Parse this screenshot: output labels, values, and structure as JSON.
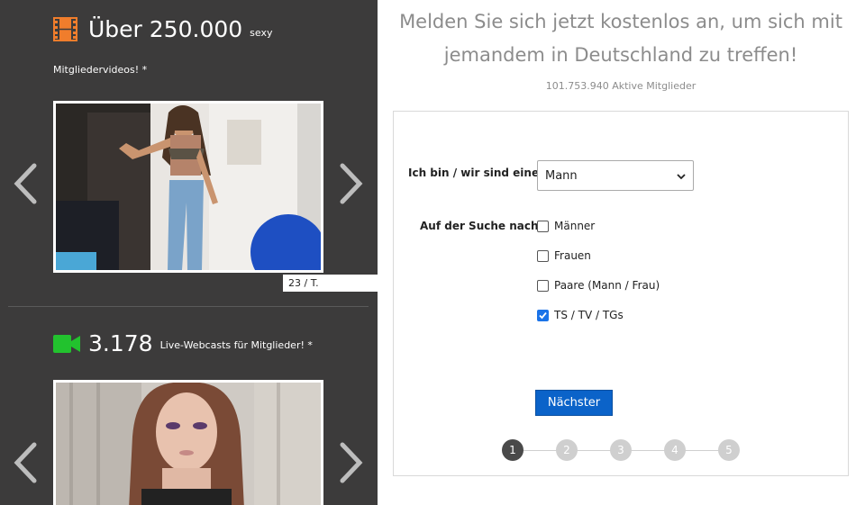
{
  "promo": {
    "videos_count": "Über 250.000",
    "videos_suffix": "sexy",
    "videos_sub": "Mitgliedervideos! *",
    "video_badge": "23 / T.",
    "webcams_count": "3.178",
    "webcams_suffix": "Live-Webcasts für Mitglieder! *"
  },
  "signup": {
    "headline": "Melden Sie sich jetzt kostenlos an, um sich mit jemandem in Deutschland zu treffen!",
    "members": "101.753.940 Aktive Mitglieder",
    "iam_label": "Ich bin / wir sind eine",
    "iam_value": "Mann",
    "seeking_label": "Auf der Suche nach",
    "options": [
      {
        "label": "Männer",
        "checked": false
      },
      {
        "label": "Frauen",
        "checked": false
      },
      {
        "label": "Paare (Mann / Frau)",
        "checked": false
      },
      {
        "label": "TS / TV / TGs",
        "checked": true
      }
    ],
    "next_label": "Nächster",
    "steps": [
      "1",
      "2",
      "3",
      "4",
      "5"
    ],
    "active_step": 1
  },
  "colors": {
    "panel_bg": "#3c3b3b",
    "film_icon": "#f07d2c",
    "cam_icon": "#22c22e",
    "button": "#0b63c9"
  },
  "icons": [
    "film-icon",
    "camera-icon",
    "chevron-left-icon",
    "chevron-right-icon",
    "chevron-down-icon",
    "checkmark-icon"
  ]
}
